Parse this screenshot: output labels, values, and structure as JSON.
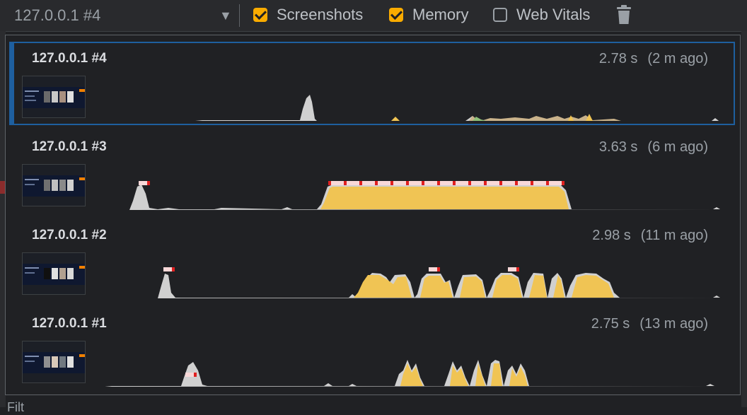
{
  "toolbar": {
    "selected_recording": "127.0.0.1 #4",
    "screenshots_label": "Screenshots",
    "screenshots_checked": true,
    "memory_label": "Memory",
    "memory_checked": true,
    "web_vitals_label": "Web Vitals",
    "web_vitals_checked": false
  },
  "recordings": [
    {
      "title": "127.0.0.1 #4",
      "duration": "2.78 s",
      "ago": "(2 m ago)",
      "selected": true
    },
    {
      "title": "127.0.0.1 #3",
      "duration": "3.63 s",
      "ago": "(6 m ago)",
      "selected": false
    },
    {
      "title": "127.0.0.1 #2",
      "duration": "2.98 s",
      "ago": "(11 m ago)",
      "selected": false
    },
    {
      "title": "127.0.0.1 #1",
      "duration": "2.75 s",
      "ago": "(13 m ago)",
      "selected": false
    }
  ],
  "colors": {
    "scripting": "#f0c454",
    "system": "#d0d0d0",
    "rendering": "#8fbf79",
    "long_task": "#e02020",
    "selected_border": "#1e5f9f"
  },
  "bottom_label": "Filt"
}
